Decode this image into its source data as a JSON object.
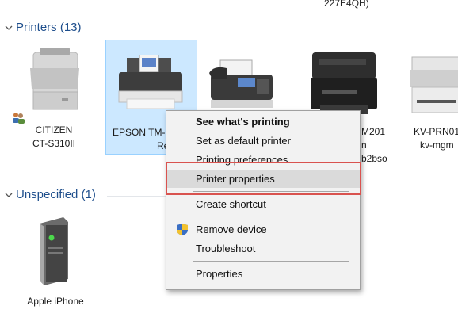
{
  "top_fragment": "227E4QH)",
  "groups": {
    "printers": {
      "title": "Printers (13)"
    },
    "unspecified": {
      "title": "Unspecified (1)"
    }
  },
  "devices": {
    "citizen": {
      "line1": "CITIZEN",
      "line2": "CT-S310II"
    },
    "epson": {
      "line1": "EPSON TM-",
      "line2": "Receipt"
    },
    "laser_m201": {
      "line1": "M201",
      "line2": "n",
      "line3": "b2bso"
    },
    "kv_prn": {
      "line1": "KV-PRN01",
      "line2": "kv-mgm"
    },
    "iphone": {
      "line1": "Apple iPhone"
    }
  },
  "context_menu": {
    "items": [
      {
        "label": "See what's printing",
        "bold": true
      },
      {
        "label": "Set as default printer"
      },
      {
        "label": "Printing preferences"
      },
      {
        "label": "Printer properties",
        "hover": true
      },
      {
        "label": "Create shortcut"
      },
      {
        "label": "Remove device",
        "icon": "uac-shield-icon"
      },
      {
        "label": "Troubleshoot"
      },
      {
        "label": "Properties"
      }
    ]
  },
  "colors": {
    "group_header": "#1e4e8c",
    "selection_bg": "#cce8ff",
    "highlight_border": "#d9534f",
    "menu_bg": "#f2f2f2"
  }
}
